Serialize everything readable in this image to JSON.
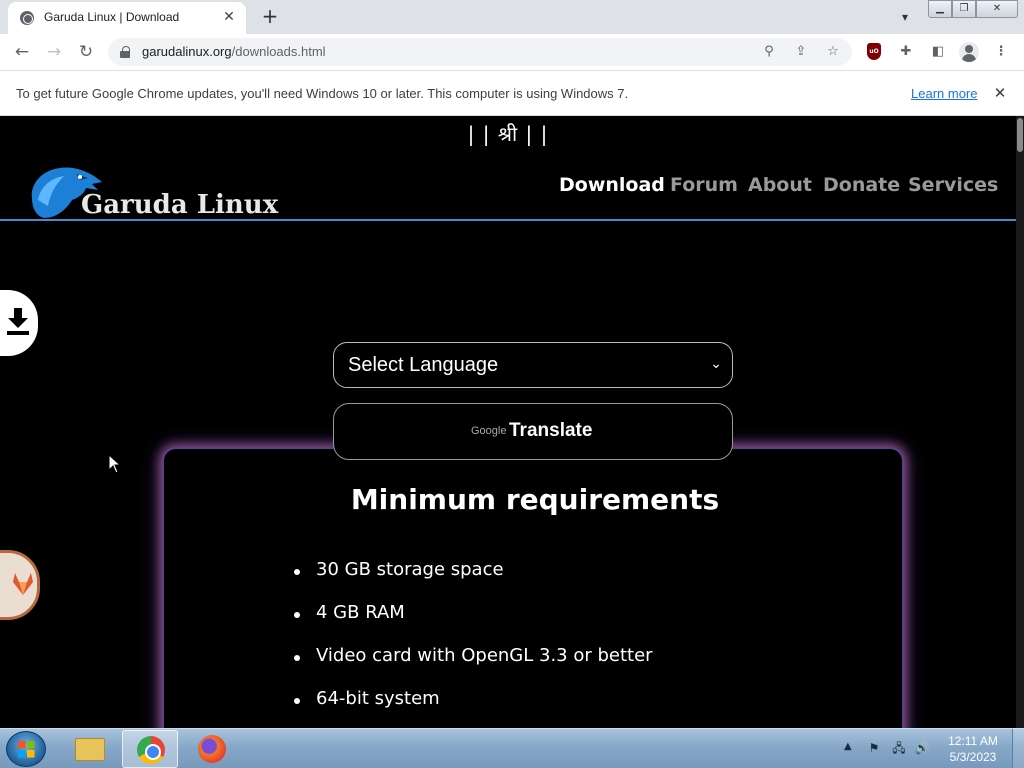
{
  "browser": {
    "tab_title": "Garuda Linux | Download",
    "tab_close": "✕",
    "new_tab": "+",
    "url_host": "garudalinux.org",
    "url_path": "/downloads.html",
    "infobar_text": "To get future Google Chrome updates, you'll need Windows 10 or later. This computer is using Windows 7.",
    "infobar_link": "Learn more",
    "infobar_close": "✕",
    "ublock_label": "uO"
  },
  "page": {
    "shri": "| | श्री | |",
    "logo_text": "Garuda Linux",
    "nav": [
      "Download",
      "Forum",
      "About",
      "Donate",
      "Services"
    ],
    "active_nav": "Download",
    "language_select": "Select Language",
    "translate_google": "Google",
    "translate_label": "Translate",
    "requirements_title": "Minimum requirements",
    "requirements": [
      "30 GB storage space",
      "4 GB RAM",
      "Video card with OpenGL 3.3 or better",
      "64-bit system"
    ]
  },
  "taskbar": {
    "apps": [
      "windows-explorer",
      "google-chrome",
      "firefox"
    ],
    "clock_time": "12:11 AM",
    "clock_date": "5/3/2023"
  },
  "colors": {
    "header_rule": "#3b8fd0",
    "nav_active": "#ffffff",
    "nav_inactive": "#9a9a9a",
    "card_glow": "#dc78b4"
  }
}
